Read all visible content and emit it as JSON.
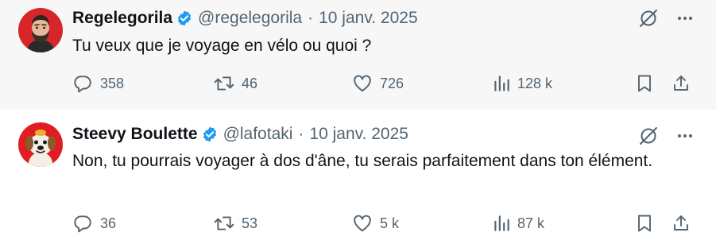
{
  "tweets": [
    {
      "author_name": "Regelegorila",
      "handle": "@regelegorila",
      "separator": "·",
      "date": "10 janv. 2025",
      "text": "Tu veux que je voyage en vélo ou quoi ?",
      "replies": "358",
      "retweets": "46",
      "likes": "726",
      "views": "128 k",
      "verified_color": "#1d9bf0",
      "avatar": "bearded-man-avatar-red-background"
    },
    {
      "author_name": "Steevy Boulette",
      "handle": "@lafotaki",
      "separator": "·",
      "date": "10 janv. 2025",
      "text": "Non, tu pourrais voyager à dos d'âne, tu serais parfaitement dans ton élément.",
      "replies": "36",
      "retweets": "53",
      "likes": "5 k",
      "views": "87 k",
      "verified_color": "#1d9bf0",
      "avatar": "cartoon-dog-avatar-red-background"
    }
  ],
  "icons": {
    "reply": "reply-icon",
    "retweet": "retweet-icon",
    "like": "like-icon",
    "views": "views-icon",
    "bookmark": "bookmark-icon",
    "share": "share-icon",
    "grok": "grok-icon",
    "more": "more-icon",
    "verified": "verified-badge-icon"
  },
  "colors": {
    "text_primary": "#0f1419",
    "text_secondary": "#536471",
    "thread_line": "#cfd9de",
    "highlight_bg": "#f7f7f7",
    "verified": "#1d9bf0"
  }
}
